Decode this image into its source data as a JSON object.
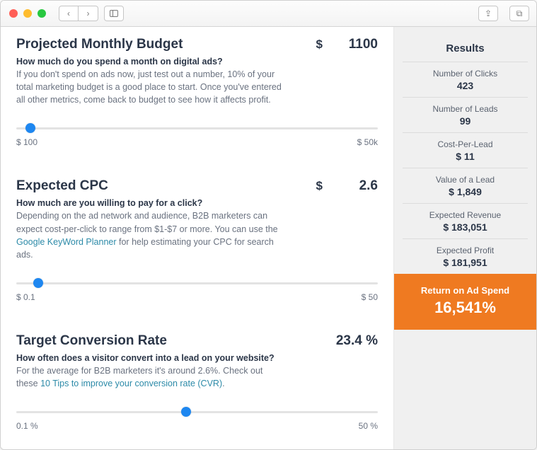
{
  "sections": {
    "budget": {
      "title": "Projected Monthly Budget",
      "currency": "$",
      "value": "1100",
      "subhead": "How much do you spend a month on digital ads?",
      "desc_a": "If you don't spend on ads now, just test out a number, 10% of your total marketing budget is a good place to start. Once you've entered all other metrics, come back to budget to see how it affects profit.",
      "slider": {
        "min": "$ 100",
        "max": "$ 50k",
        "pct": 4
      }
    },
    "cpc": {
      "title": "Expected CPC",
      "currency": "$",
      "value": "2.6",
      "subhead": "How much are you willing to pay for a click?",
      "desc_a": "Depending on the ad network and audience, B2B marketers can expect cost-per-click to range from $1-$7 or more. You can use the ",
      "link1": "Google KeyWord Planner",
      "desc_b": " for help estimating your CPC for search ads.",
      "slider": {
        "min": "$ 0.1",
        "max": "$ 50",
        "pct": 6
      }
    },
    "cvr": {
      "title": "Target Conversion Rate",
      "value": "23.4 %",
      "subhead": "How often does a visitor convert into a lead on your website?",
      "desc_a": "For the average for B2B marketers it's around 2.6%. Check out these ",
      "link1": "10 Tips to improve your conversion rate (CVR)",
      "desc_b": ".",
      "slider": {
        "min": "0.1 %",
        "max": "50 %",
        "pct": 47
      }
    }
  },
  "results": {
    "title": "Results",
    "items": [
      {
        "label": "Number of Clicks",
        "value": "423"
      },
      {
        "label": "Number of Leads",
        "value": "99"
      },
      {
        "label": "Cost-Per-Lead",
        "value": "$ 11"
      },
      {
        "label": "Value of a Lead",
        "value": "$ 1,849"
      },
      {
        "label": "Expected Revenue",
        "value": "$ 183,051"
      },
      {
        "label": "Expected Profit",
        "value": "$ 181,951"
      }
    ],
    "roas": {
      "label": "Return on Ad Spend",
      "value": "16,541%"
    }
  }
}
